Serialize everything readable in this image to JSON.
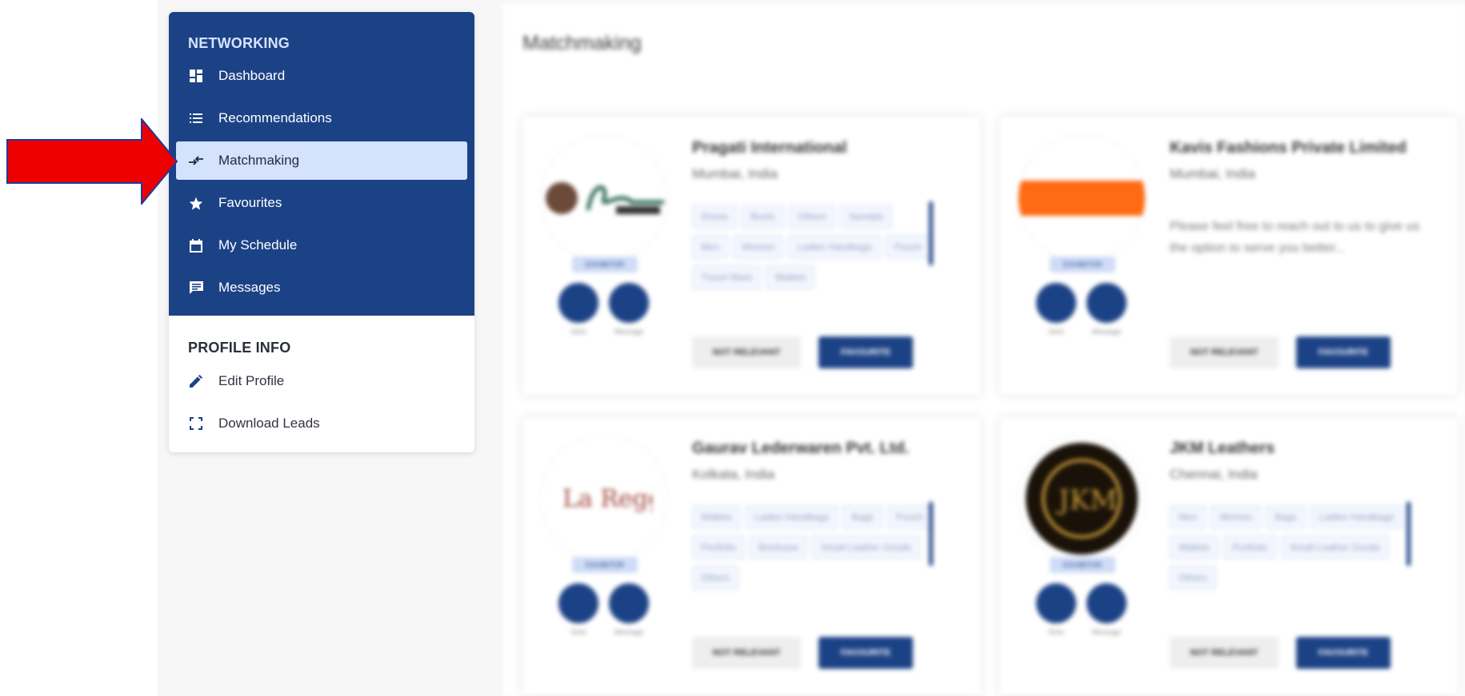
{
  "sidebar": {
    "networking": {
      "title": "NETWORKING",
      "items": [
        {
          "label": "Dashboard",
          "icon": "dashboard-icon"
        },
        {
          "label": "Recommendations",
          "icon": "list-icon"
        },
        {
          "label": "Matchmaking",
          "icon": "compare-arrows-icon",
          "active": true
        },
        {
          "label": "Favourites",
          "icon": "star-icon"
        },
        {
          "label": "My Schedule",
          "icon": "calendar-icon"
        },
        {
          "label": "Messages",
          "icon": "message-icon"
        }
      ]
    },
    "profile": {
      "title": "PROFILE INFO",
      "items": [
        {
          "label": "Edit Profile",
          "icon": "pencil-icon"
        },
        {
          "label": "Download Leads",
          "icon": "fullscreen-icon"
        }
      ]
    }
  },
  "main": {
    "title": "Matchmaking",
    "cards": [
      {
        "name": "Pragati International",
        "location": "Mumbai, India",
        "badge": "EXHIBITOR",
        "tags": [
          "Shoes",
          "Boots",
          "Others",
          "Sandals",
          "Men",
          "Women",
          "Ladies Handbags",
          "Pouch",
          "Travel Ware",
          "Wallets"
        ],
        "action_labels": [
          "Slots",
          "Message"
        ],
        "not_relevant": "NOT RELEVANT",
        "favourite": "FAVOURITE"
      },
      {
        "name": "Kavis Fashions Private Limited",
        "location": "Mumbai, India",
        "badge": "EXHIBITOR",
        "description": "Please feel free to reach out to us to give us the option to serve you better...",
        "action_labels": [
          "Slots",
          "Message"
        ],
        "not_relevant": "NOT RELEVANT",
        "favourite": "FAVOURITE"
      },
      {
        "name": "Gaurav Lederwaren Pvt. Ltd.",
        "location": "Kolkata, India",
        "badge": "EXHIBITOR",
        "tags": [
          "Wallets",
          "Ladies Handbags",
          "Bags",
          "Pouch",
          "Portfolio",
          "Briefcase",
          "Small Leather Goods",
          "Others"
        ],
        "action_labels": [
          "Slots",
          "Message"
        ],
        "not_relevant": "NOT RELEVANT",
        "favourite": "FAVOURITE"
      },
      {
        "name": "JKM Leathers",
        "location": "Chennai, India",
        "badge": "EXHIBITOR",
        "tags": [
          "Men",
          "Women",
          "Bags",
          "Ladies Handbags",
          "Wallets",
          "Portfolio",
          "Small Leather Goods",
          "Others"
        ],
        "action_labels": [
          "Slots",
          "Message"
        ],
        "not_relevant": "NOT RELEVANT",
        "favourite": "FAVOURITE"
      }
    ]
  },
  "colors": {
    "primary": "#1c4286",
    "active_bg": "#d4e2fc",
    "arrow": "#ee0000"
  }
}
